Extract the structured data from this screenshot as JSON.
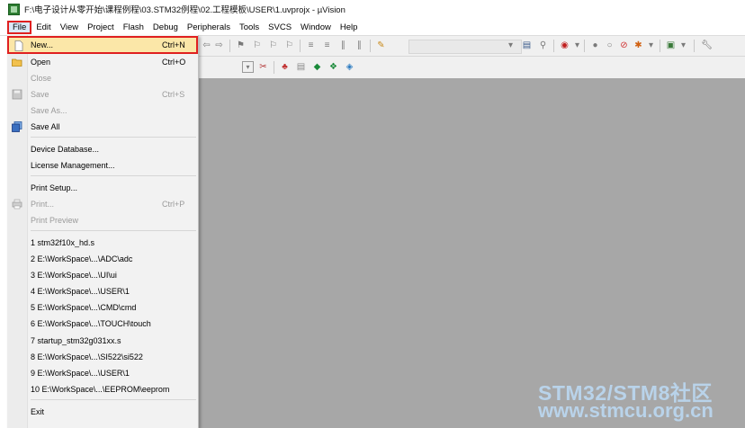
{
  "window": {
    "title": "F:\\电子设计从零开始\\课程例程\\03.STM32例程\\02.工程模板\\USER\\1.uvprojx - µVision"
  },
  "menubar": {
    "items": [
      "File",
      "Edit",
      "View",
      "Project",
      "Flash",
      "Debug",
      "Peripherals",
      "Tools",
      "SVCS",
      "Window",
      "Help"
    ]
  },
  "file_menu": {
    "new": {
      "label": "New...",
      "shortcut": "Ctrl+N"
    },
    "open": {
      "label": "Open",
      "shortcut": "Ctrl+O"
    },
    "close": {
      "label": "Close"
    },
    "save": {
      "label": "Save",
      "shortcut": "Ctrl+S"
    },
    "save_as": {
      "label": "Save As..."
    },
    "save_all": {
      "label": "Save All"
    },
    "device_database": {
      "label": "Device Database..."
    },
    "license_management": {
      "label": "License Management..."
    },
    "print_setup": {
      "label": "Print Setup..."
    },
    "print": {
      "label": "Print...",
      "shortcut": "Ctrl+P"
    },
    "print_preview": {
      "label": "Print Preview"
    },
    "recent_files": [
      "1 stm32f10x_hd.s",
      "2 E:\\WorkSpace\\...\\ADC\\adc",
      "3 E:\\WorkSpace\\...\\UI\\ui",
      "4 E:\\WorkSpace\\...\\USER\\1",
      "5 E:\\WorkSpace\\...\\CMD\\cmd",
      "6 E:\\WorkSpace\\...\\TOUCH\\touch",
      "7 startup_stm32g031xx.s",
      "8 E:\\WorkSpace\\...\\SI522\\si522",
      "9 E:\\WorkSpace\\...\\USER\\1",
      "10 E:\\WorkSpace\\...\\EEPROM\\eeprom"
    ],
    "exit": {
      "label": "Exit"
    }
  },
  "watermark": {
    "line1": "STM32/STM8社区",
    "line2": "www.stmcu.org.cn"
  },
  "colors": {
    "highlight_border": "#e02020",
    "highlight_fill": "#fbe7a8",
    "workspace": "#a7a7a7"
  }
}
